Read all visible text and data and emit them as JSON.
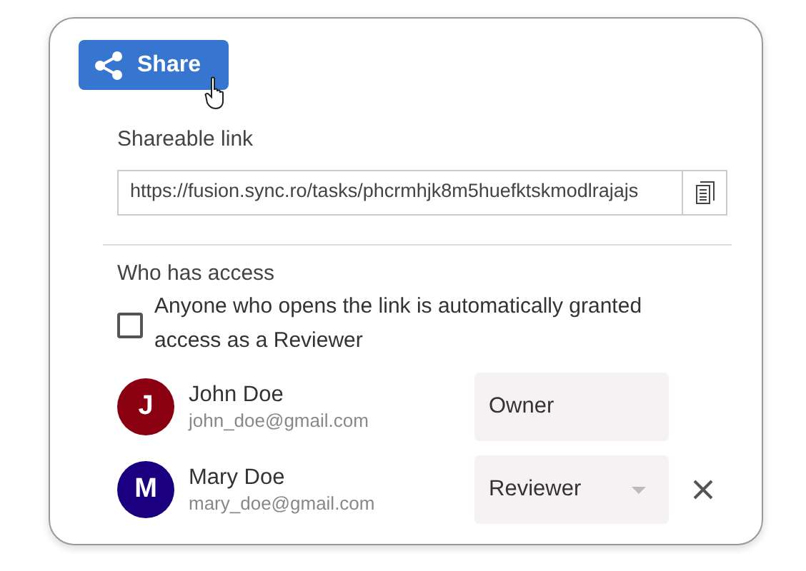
{
  "share_button": {
    "label": "Share"
  },
  "link": {
    "label": "Shareable link",
    "value": "https://fusion.sync.ro/tasks/phcrmhjk8m5huefktskmodlrajajs"
  },
  "access": {
    "title": "Who has access",
    "public_option": {
      "label": "Anyone who opens the link is automatically granted access as a Reviewer",
      "checked": false
    }
  },
  "members": [
    {
      "initial": "J",
      "color": "#8b0010",
      "name": "John Doe",
      "email": "john_doe@gmail.com",
      "role": "Owner",
      "kind": "fixed",
      "removable": false
    },
    {
      "initial": "M",
      "color": "#1a0080",
      "name": "Mary Doe",
      "email": "mary_doe@gmail.com",
      "role": "Reviewer",
      "kind": "dropdown",
      "removable": true
    }
  ]
}
